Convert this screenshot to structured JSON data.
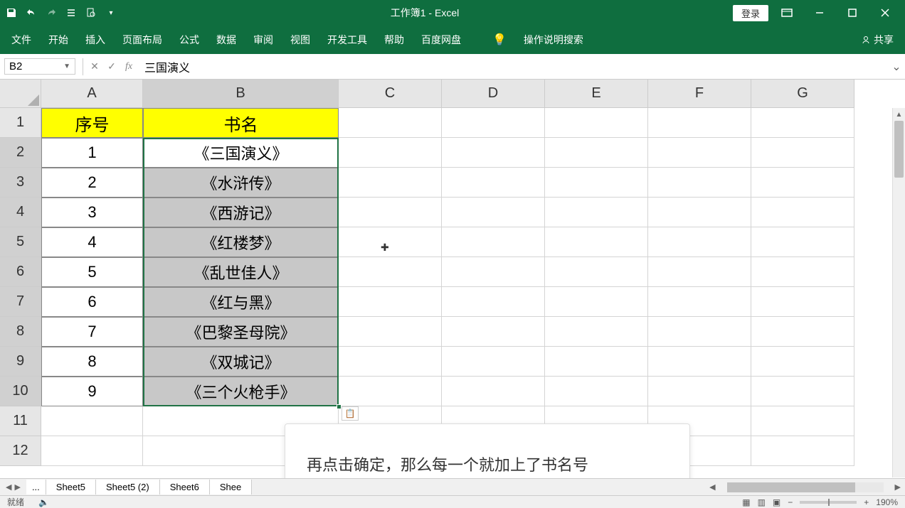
{
  "titlebar": {
    "title": "工作簿1 - Excel",
    "login": "登录"
  },
  "ribbon": {
    "tabs": [
      "文件",
      "开始",
      "插入",
      "页面布局",
      "公式",
      "数据",
      "审阅",
      "视图",
      "开发工具",
      "帮助",
      "百度网盘"
    ],
    "tell_me": "操作说明搜索",
    "share": "共享"
  },
  "formula_bar": {
    "cell_ref": "B2",
    "formula": "三国演义"
  },
  "columns": [
    "A",
    "B",
    "C",
    "D",
    "E",
    "F",
    "G"
  ],
  "rows": [
    "1",
    "2",
    "3",
    "4",
    "5",
    "6",
    "7",
    "8",
    "9",
    "10",
    "11",
    "12"
  ],
  "table": {
    "headers": {
      "a": "序号",
      "b": "书名"
    },
    "data": [
      {
        "num": "1",
        "name": "《三国演义》"
      },
      {
        "num": "2",
        "name": "《水浒传》"
      },
      {
        "num": "3",
        "name": "《西游记》"
      },
      {
        "num": "4",
        "name": "《红楼梦》"
      },
      {
        "num": "5",
        "name": "《乱世佳人》"
      },
      {
        "num": "6",
        "name": "《红与黑》"
      },
      {
        "num": "7",
        "name": "《巴黎圣母院》"
      },
      {
        "num": "8",
        "name": "《双城记》"
      },
      {
        "num": "9",
        "name": "《三个火枪手》"
      }
    ]
  },
  "tooltip": "再点击确定，那么每一个就加上了书名号",
  "sheets": {
    "ellipsis": "...",
    "tabs": [
      "Sheet5",
      "Sheet5 (2)",
      "Sheet6",
      "Shee"
    ]
  },
  "status": {
    "ready": "就绪",
    "zoom": "190%"
  }
}
